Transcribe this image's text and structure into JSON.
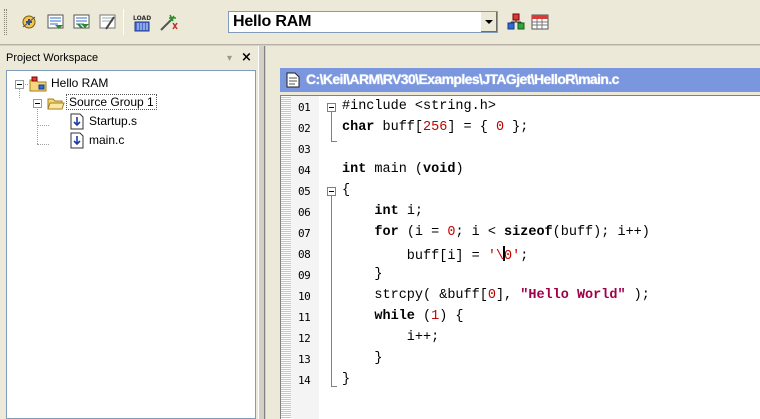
{
  "toolbar": {
    "buttons": [
      {
        "name": "build-target-icon"
      },
      {
        "name": "translate-icon"
      },
      {
        "name": "rebuild-all-icon"
      },
      {
        "name": "stop-build-icon"
      },
      {
        "name": "download-icon",
        "text": "LOAD"
      },
      {
        "name": "target-options-icon"
      }
    ],
    "target_select": {
      "value": "Hello RAM"
    },
    "extra_buttons": [
      {
        "name": "components-icon"
      },
      {
        "name": "project-settings-icon"
      }
    ]
  },
  "workspace": {
    "title": "Project Workspace",
    "pin": "▾",
    "close": "×",
    "tree": {
      "root": {
        "label": "Hello RAM"
      },
      "group": {
        "label": "Source Group 1"
      },
      "files": [
        {
          "label": "Startup.s"
        },
        {
          "label": "main.c"
        }
      ]
    }
  },
  "editor": {
    "path": "C:\\Keil\\ARM\\RV30\\Examples\\JTAGjet\\HelloR\\main.c",
    "line_numbers": [
      "01",
      "02",
      "03",
      "04",
      "05",
      "06",
      "07",
      "08",
      "09",
      "10",
      "11",
      "12",
      "13",
      "14"
    ],
    "lines": [
      "#include <string.h>",
      "char buff[256] = { 0 };",
      "",
      "int main (void)",
      "{",
      "    int i;",
      "    for (i = 0; i < sizeof(buff); i++)",
      "        buff[i] = '\\0';",
      "    }",
      "    strcpy( &buff[0], \"Hello World\" );",
      "    while (1) {",
      "        i++;",
      "    }",
      "}"
    ]
  },
  "colors": {
    "editor_title_bar": "#7a96df",
    "keyword": "#000000",
    "literal": "#c00000",
    "string": "#a0004a"
  }
}
